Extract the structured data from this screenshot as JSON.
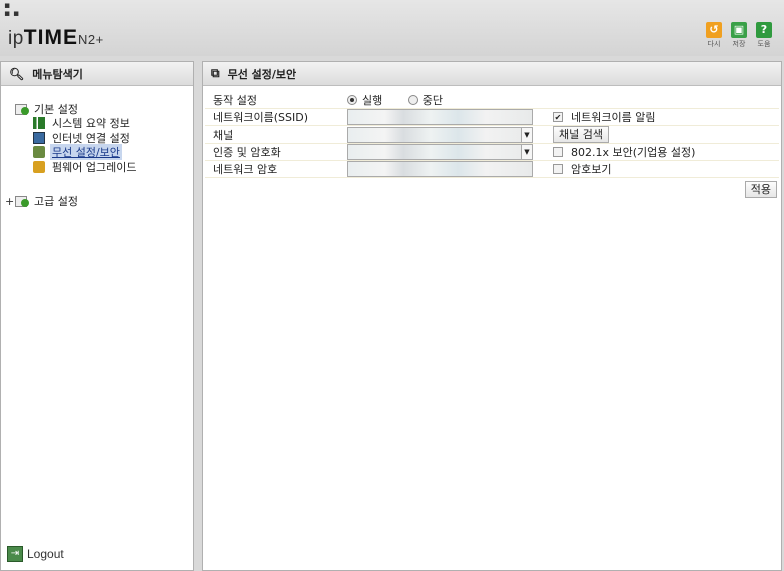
{
  "header": {
    "logo_prefix": "ip",
    "logo_bold": "TIME",
    "logo_model": "N2+",
    "buttons": [
      {
        "icon": "refresh-icon",
        "label": "다시"
      },
      {
        "icon": "save-icon",
        "label": "저장"
      },
      {
        "icon": "help-icon",
        "label": "도움"
      }
    ]
  },
  "sidebar": {
    "title": "메뉴탐색기",
    "basic_group": "기본 설정",
    "items": [
      {
        "label": "시스템 요약 정보",
        "icon": "chart-icon"
      },
      {
        "label": "인터넷 연결 설정",
        "icon": "network-icon"
      },
      {
        "label": "무선 설정/보안",
        "icon": "wireless-icon",
        "active": true
      },
      {
        "label": "펌웨어 업그레이드",
        "icon": "firmware-icon"
      }
    ],
    "advanced_expander": "+",
    "advanced_group": "고급 설정",
    "logout": "Logout"
  },
  "main": {
    "title": "무선 설정/보안",
    "operation": {
      "label": "동작 설정",
      "options": [
        "실행",
        "중단"
      ],
      "selected": "실행"
    },
    "ssid": {
      "label": "네트워크이름(SSID)",
      "broadcast_label": "네트워크이름 알림",
      "broadcast_checked": true
    },
    "channel": {
      "label": "채널",
      "search_button": "채널 검색"
    },
    "auth": {
      "label": "인증 및 암호화",
      "enterprise_label": "802.1x 보안(기업용 설정)",
      "enterprise_checked": false
    },
    "password": {
      "label": "네트워크 암호",
      "show_label": "암호보기",
      "show_checked": false
    },
    "apply_button": "적용"
  }
}
